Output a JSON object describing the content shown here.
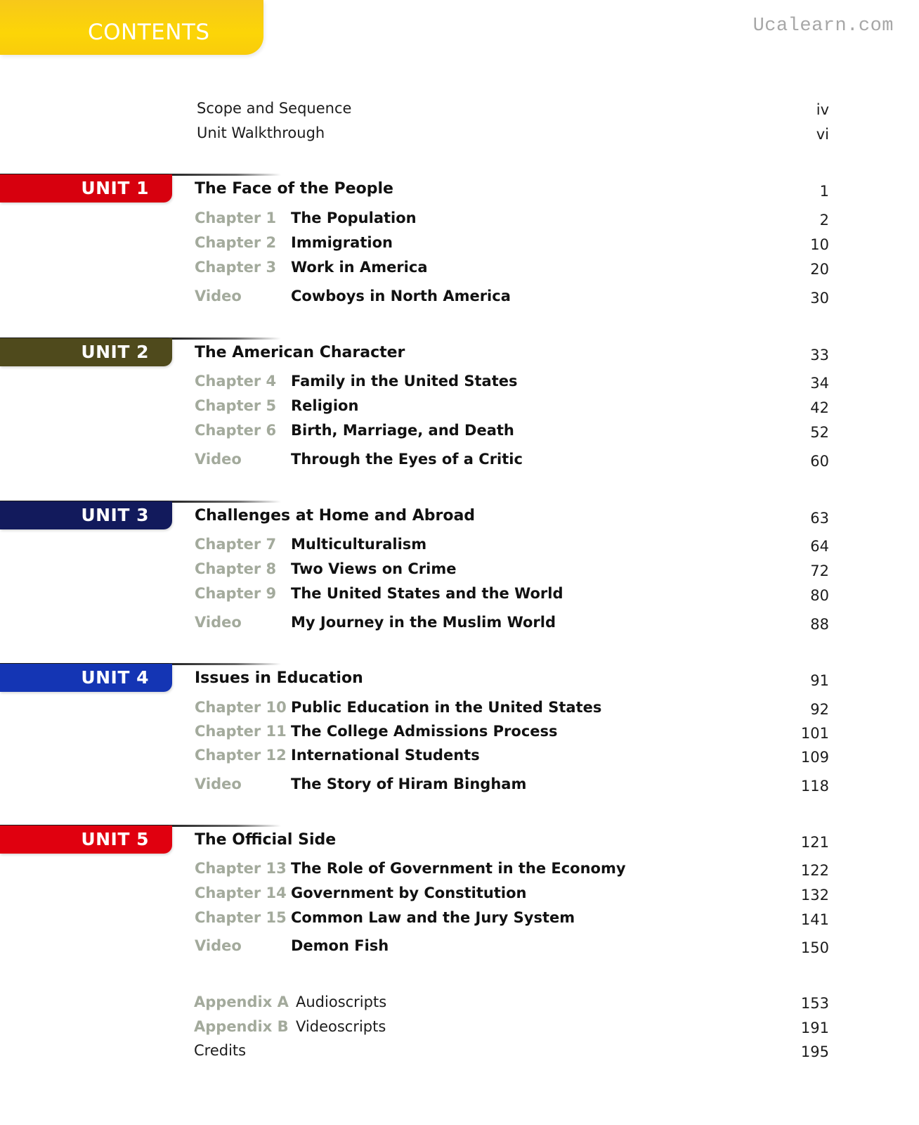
{
  "header": {
    "title": "CONTENTS",
    "watermark": "Ucalearn.com",
    "tab_color": "#fcd507"
  },
  "front_matter": [
    {
      "label": "Scope and Sequence",
      "page": "iv"
    },
    {
      "label": "Unit Walkthrough",
      "page": "vi"
    }
  ],
  "units": [
    {
      "label": "UNIT 1",
      "title": "The Face of the People",
      "page": "1",
      "color": "#d7000e",
      "entries": [
        {
          "kind": "Chapter 1",
          "title": "The Population",
          "page": "2"
        },
        {
          "kind": "Chapter 2",
          "title": "Immigration",
          "page": "10"
        },
        {
          "kind": "Chapter 3",
          "title": "Work in America",
          "page": "20"
        },
        {
          "kind": "Video",
          "title": "Cowboys in North America",
          "page": "30"
        }
      ]
    },
    {
      "label": "UNIT 2",
      "title": "The American Character",
      "page": "33",
      "color": "#4f4a1c",
      "entries": [
        {
          "kind": "Chapter 4",
          "title": "Family in the United States",
          "page": "34"
        },
        {
          "kind": "Chapter 5",
          "title": "Religion",
          "page": "42"
        },
        {
          "kind": "Chapter 6",
          "title": "Birth, Marriage, and Death",
          "page": "52"
        },
        {
          "kind": "Video",
          "title": "Through the Eyes of a Critic",
          "page": "60"
        }
      ]
    },
    {
      "label": "UNIT 3",
      "title": "Challenges at Home and Abroad",
      "page": "63",
      "color": "#121a5c",
      "entries": [
        {
          "kind": "Chapter 7",
          "title": "Multiculturalism",
          "page": "64"
        },
        {
          "kind": "Chapter 8",
          "title": "Two Views on Crime",
          "page": "72"
        },
        {
          "kind": "Chapter 9",
          "title": "The United States and the World",
          "page": "80"
        },
        {
          "kind": "Video",
          "title": "My Journey in the Muslim World",
          "page": "88"
        }
      ]
    },
    {
      "label": "UNIT 4",
      "title": "Issues in Education",
      "page": "91",
      "color": "#1435b4",
      "entries": [
        {
          "kind": "Chapter 10",
          "title": "Public Education in the United States",
          "page": "92"
        },
        {
          "kind": "Chapter 11",
          "title": "The College Admissions Process",
          "page": "101"
        },
        {
          "kind": "Chapter 12",
          "title": "International Students",
          "page": "109"
        },
        {
          "kind": "Video",
          "title": "The Story of Hiram Bingham",
          "page": "118"
        }
      ]
    },
    {
      "label": "UNIT 5",
      "title": "The Official Side",
      "page": "121",
      "color": "#e0000f",
      "entries": [
        {
          "kind": "Chapter 13",
          "title": "The Role of Government in the Economy",
          "page": "122"
        },
        {
          "kind": "Chapter 14",
          "title": "Government by Constitution",
          "page": "132"
        },
        {
          "kind": "Chapter 15",
          "title": "Common Law and the Jury System",
          "page": "141"
        },
        {
          "kind": "Video",
          "title": "Demon Fish",
          "page": "150"
        }
      ]
    }
  ],
  "back_matter": {
    "appendices": [
      {
        "kind": "Appendix A",
        "title": "Audioscripts",
        "page": "153"
      },
      {
        "kind": "Appendix B",
        "title": "Videoscripts",
        "page": "191"
      }
    ],
    "credits": {
      "label": "Credits",
      "page": "195"
    }
  }
}
